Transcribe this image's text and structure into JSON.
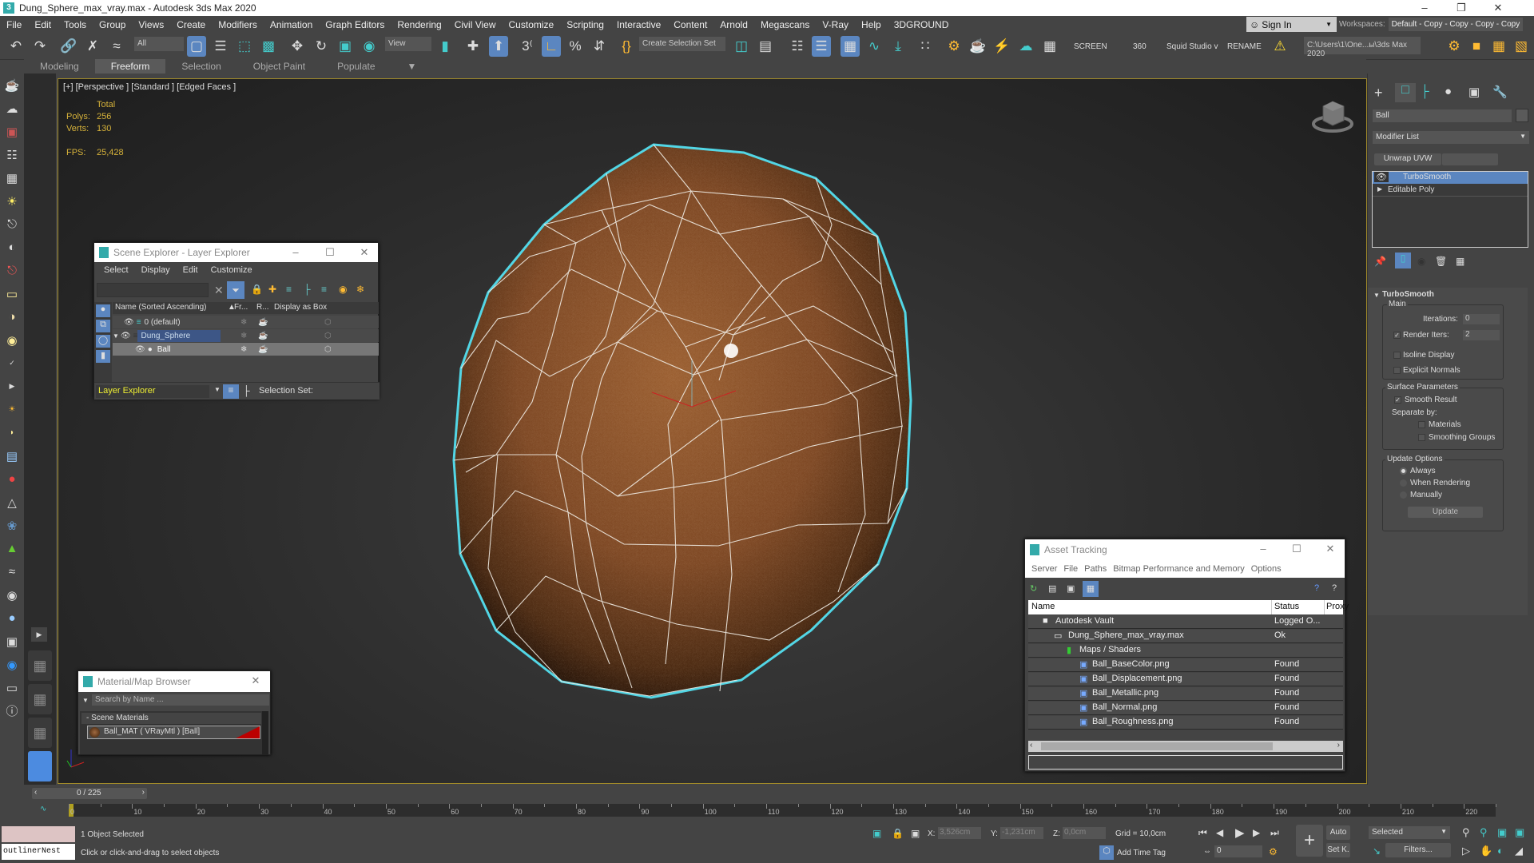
{
  "window": {
    "title": "Dung_Sphere_max_vray.max - Autodesk 3ds Max 2020",
    "controls": {
      "minimize": "–",
      "maximize": "❐",
      "close": "✕"
    }
  },
  "menubar": {
    "items": [
      "File",
      "Edit",
      "Tools",
      "Group",
      "Views",
      "Create",
      "Modifiers",
      "Animation",
      "Graph Editors",
      "Rendering",
      "Civil View",
      "Customize",
      "Scripting",
      "Interactive",
      "Content",
      "Arnold",
      "Megascans",
      "V-Ray",
      "Help",
      "3DGROUND"
    ],
    "sign_in": "Sign In",
    "workspaces_label": "Workspaces:",
    "workspace_value": "Default - Copy - Copy - Copy - Copy"
  },
  "toolbar": {
    "selection_filter": "All",
    "reference_coord": "View",
    "named_selection": "Create Selection Set",
    "text_buttons": [
      "SCREEN",
      "360",
      "Squid Studio v",
      "RENAME"
    ],
    "project_path": "C:\\Users\\1\\One...ы\\3ds Max 2020"
  },
  "ribbon": {
    "tabs": [
      "Modeling",
      "Freeform",
      "Selection",
      "Object Paint",
      "Populate"
    ],
    "active": "Freeform"
  },
  "viewport": {
    "label": "[+] [Perspective ] [Standard ] [Edged Faces ]",
    "stats": {
      "total_label": "Total",
      "polys_label": "Polys:",
      "polys": "256",
      "verts_label": "Verts:",
      "verts": "130",
      "fps_label": "FPS:",
      "fps": "25,428"
    },
    "object_color": "#8a5228",
    "selection_color": "#4fd6e6"
  },
  "scene_explorer": {
    "title": "Scene Explorer - Layer Explorer",
    "menu": [
      "Select",
      "Display",
      "Edit",
      "Customize"
    ],
    "columns": [
      "Name (Sorted Ascending)",
      "Fr...",
      "R...",
      "Display as Box"
    ],
    "rows": [
      {
        "name": "0 (default)",
        "level": 0
      },
      {
        "name": "Dung_Sphere",
        "level": 0,
        "highlighted": true
      },
      {
        "name": "Ball",
        "level": 1,
        "selected": true
      }
    ],
    "explorer_name": "Layer Explorer",
    "selection_set_label": "Selection Set:"
  },
  "asset_tracking": {
    "title": "Asset Tracking",
    "menu": [
      "Server",
      "File",
      "Paths",
      "Bitmap Performance and Memory",
      "Options"
    ],
    "columns": [
      "Name",
      "Status",
      "Proxy"
    ],
    "rows": [
      {
        "name": "Autodesk Vault",
        "status": "Logged O...",
        "level": 0
      },
      {
        "name": "Dung_Sphere_max_vray.max",
        "status": "Ok",
        "level": 1
      },
      {
        "name": "Maps / Shaders",
        "status": "",
        "level": 2
      },
      {
        "name": "Ball_BaseColor.png",
        "status": "Found",
        "level": 3
      },
      {
        "name": "Ball_Displacement.png",
        "status": "Found",
        "level": 3
      },
      {
        "name": "Ball_Metallic.png",
        "status": "Found",
        "level": 3
      },
      {
        "name": "Ball_Normal.png",
        "status": "Found",
        "level": 3
      },
      {
        "name": "Ball_Roughness.png",
        "status": "Found",
        "level": 3
      }
    ]
  },
  "material_browser": {
    "title": "Material/Map Browser",
    "search_placeholder": "Search by Name ...",
    "group": "- Scene Materials",
    "item": "Ball_MAT  ( VRayMtl )  [Ball]"
  },
  "command_panel": {
    "object_name": "Ball",
    "modifier_list": "Modifier List",
    "quick_button": "Unwrap UVW",
    "stack": [
      "TurboSmooth",
      "Editable Poly"
    ],
    "rollout_title": "TurboSmooth",
    "main_group": "Main",
    "iterations_label": "Iterations:",
    "iterations": "0",
    "render_iters_label": "Render Iters:",
    "render_iters": "2",
    "render_iters_checked": true,
    "isoline_label": "Isoline Display",
    "isoline": false,
    "explicit_normals_label": "Explicit Normals",
    "explicit_normals": false,
    "surface_group": "Surface Parameters",
    "smooth_result_label": "Smooth Result",
    "smooth_result": true,
    "separate_by_label": "Separate by:",
    "materials_label": "Materials",
    "materials": false,
    "smoothing_groups_label": "Smoothing Groups",
    "smoothing_groups": false,
    "update_group": "Update Options",
    "update_options": [
      "Always",
      "When Rendering",
      "Manually"
    ],
    "update_selected": "Always",
    "update_button": "Update"
  },
  "timeline": {
    "frame_display": "0 / 225",
    "ticks": [
      "0",
      "10",
      "20",
      "30",
      "40",
      "50",
      "60",
      "70",
      "80",
      "90",
      "100",
      "110",
      "120",
      "130",
      "140",
      "150",
      "160",
      "170",
      "180",
      "190",
      "200",
      "210",
      "220"
    ],
    "current_frame": 0,
    "total_frames": 225
  },
  "status": {
    "maxscript_listener": "outlinerNest",
    "selected": "1 Object Selected",
    "prompt": "Click or click-and-drag to select objects",
    "x_label": "X:",
    "x": "3,526cm",
    "y_label": "Y:",
    "y": "-1,231cm",
    "z_label": "Z:",
    "z": "0,0cm",
    "grid": "Grid = 10,0cm",
    "add_time_tag": "Add Time Tag",
    "frame_field": "0",
    "auto_key": "Auto",
    "set_key": "Set K.",
    "key_filter": "Selected",
    "filters": "Filters..."
  }
}
